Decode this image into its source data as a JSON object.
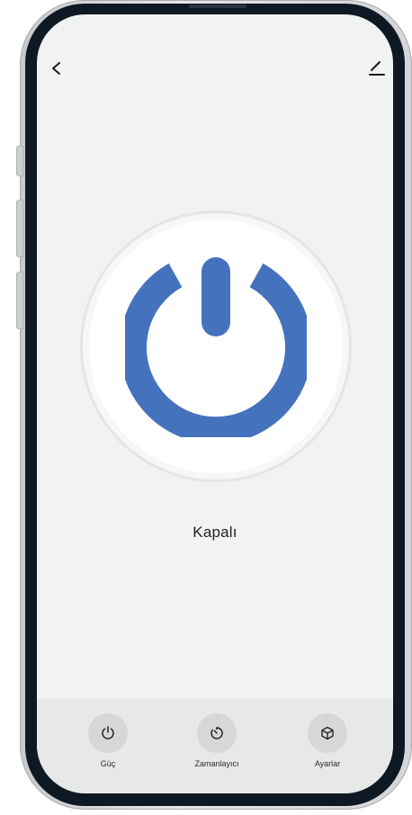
{
  "nav": {
    "back_icon": "chevron-left-icon",
    "edit_icon": "pencil-icon"
  },
  "device": {
    "power_icon": "power-icon",
    "power_color": "#4472bd",
    "status": "Kapalı"
  },
  "tabs": [
    {
      "label": "Güç",
      "icon": "power-icon"
    },
    {
      "label": "Zamanlayıcı",
      "icon": "timer-icon"
    },
    {
      "label": "Ayarlar",
      "icon": "cube-icon"
    }
  ],
  "colors": {
    "screen_bg": "#f1f2f2",
    "bottom_bar_bg": "#e7e8e8",
    "tab_circle_bg": "#d6d7d8"
  }
}
